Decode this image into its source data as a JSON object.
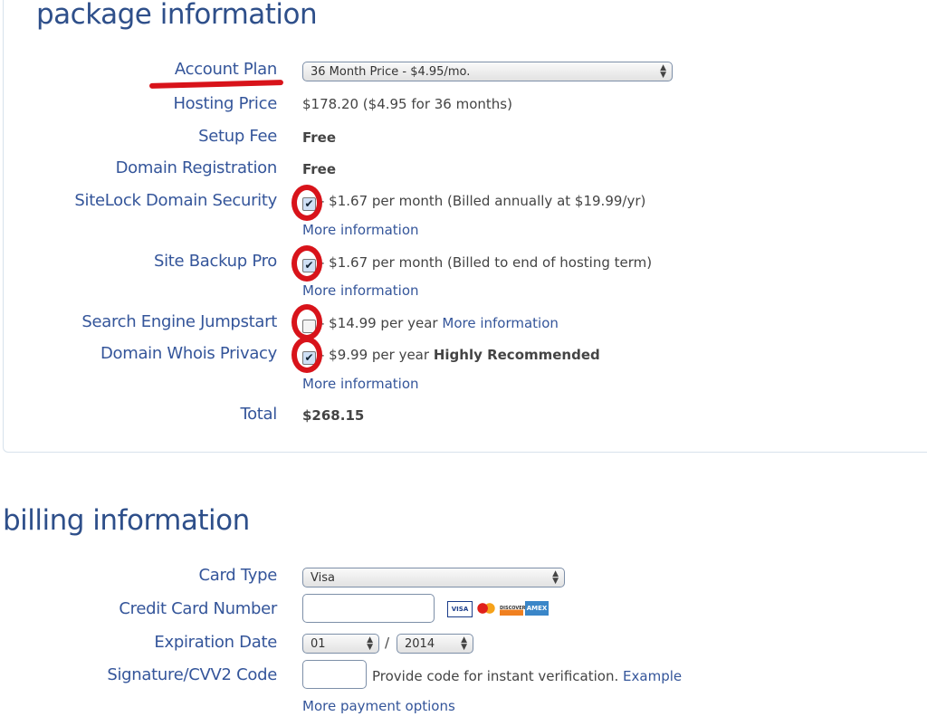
{
  "package": {
    "heading": "package information",
    "account_plan": {
      "label": "Account Plan",
      "selected": "36 Month Price - $4.95/mo."
    },
    "hosting_price": {
      "label": "Hosting Price",
      "value": "$178.20  ($4.95 for 36 months)"
    },
    "setup_fee": {
      "label": "Setup Fee",
      "value": "Free"
    },
    "domain_registration": {
      "label": "Domain Registration",
      "value": "Free"
    },
    "sitelock": {
      "label": "SiteLock Domain Security",
      "checked": true,
      "value": "- $1.67 per month (Billed annually at $19.99/yr)",
      "more": "More information"
    },
    "backup": {
      "label": "Site Backup Pro",
      "checked": true,
      "value": "- $1.67 per month (Billed to end of hosting term)",
      "more": "More information"
    },
    "jumpstart": {
      "label": "Search Engine Jumpstart",
      "checked": false,
      "value": "- $14.99 per year",
      "more": "More information"
    },
    "whois": {
      "label": "Domain Whois Privacy",
      "checked": true,
      "value": "- $9.99 per year",
      "badge": "Highly Recommended",
      "more": "More information"
    },
    "total": {
      "label": "Total",
      "value": "$268.15"
    }
  },
  "billing": {
    "heading": "billing information",
    "card_type": {
      "label": "Card Type",
      "selected": "Visa"
    },
    "card_number": {
      "label": "Credit Card Number",
      "value": ""
    },
    "card_logos": [
      "VISA",
      "MC",
      "DISCOVER",
      "AMEX"
    ],
    "expiration": {
      "label": "Expiration Date",
      "month": "01",
      "separator": "/",
      "year": "2014"
    },
    "cvv": {
      "label": "Signature/CVV2 Code",
      "hint": "Provide code for instant verification.",
      "example": "Example"
    },
    "more_payment": "More payment options"
  },
  "colors": {
    "heading": "#2e4f8a",
    "label": "#34559a",
    "annotation": "#d8131a"
  }
}
